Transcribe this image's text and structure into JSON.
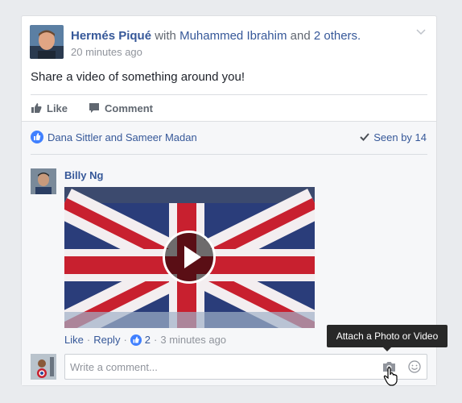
{
  "post": {
    "author": "Hermés Piqué",
    "with_word": "with",
    "tagged": "Muhammed Ibrahim",
    "and_word": "and",
    "others": "2 others.",
    "time": "20 minutes ago",
    "text": "Share a video of something around you!"
  },
  "actions": {
    "like": "Like",
    "comment": "Comment"
  },
  "reactions": {
    "likers": "Dana Sittler and Sameer Madan",
    "seen": "Seen by 14"
  },
  "comment": {
    "author": "Billy Ng",
    "like": "Like",
    "reply": "Reply",
    "like_count": "2",
    "time": "3 minutes ago",
    "sep": "·"
  },
  "composer": {
    "placeholder": "Write a comment..."
  },
  "tooltip": "Attach a Photo or Video",
  "colors": {
    "link": "#365899",
    "like_blue": "#4080ff",
    "tooltip_bg": "#282828"
  }
}
